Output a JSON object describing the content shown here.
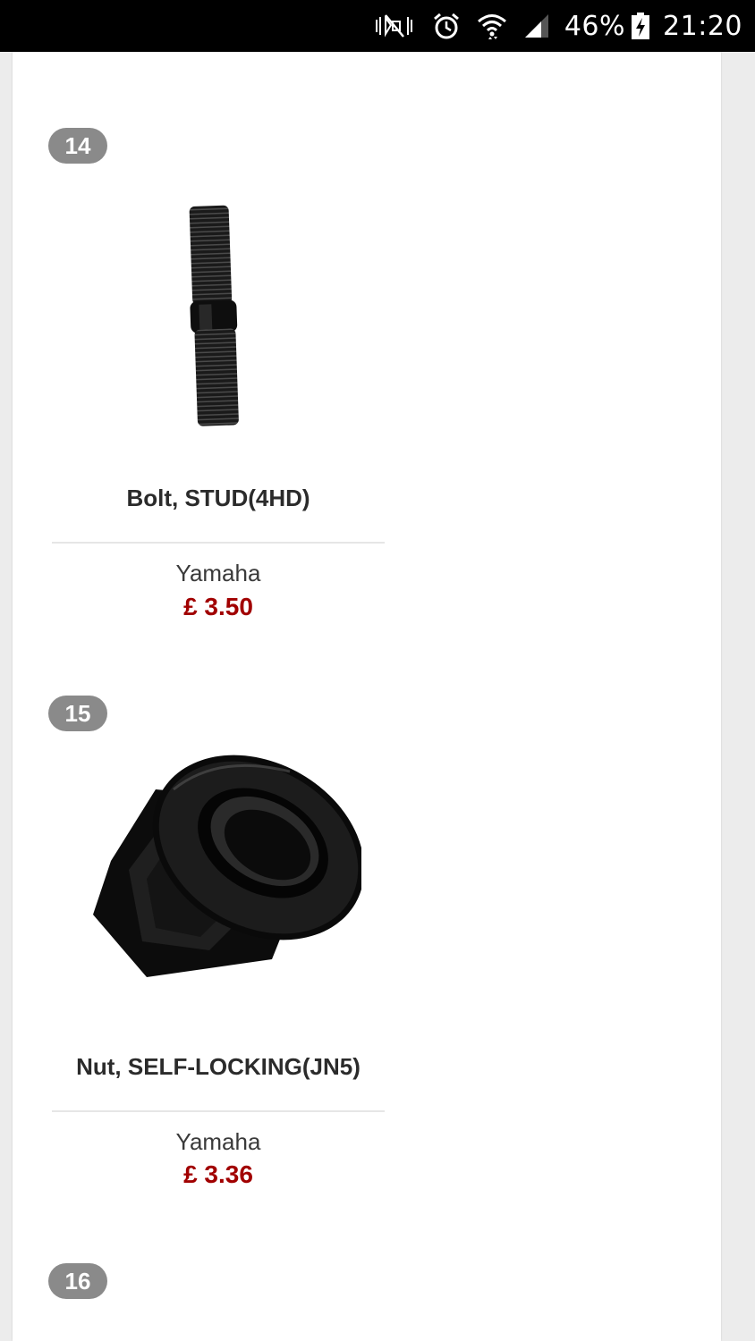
{
  "status_bar": {
    "battery_percent": "46%",
    "time": "21:20",
    "icons": [
      "mute-icon",
      "alarm-icon",
      "wifi-icon",
      "signal-icon",
      "battery-charging-icon"
    ]
  },
  "products": [
    {
      "number": "14",
      "name": "Bolt, STUD(4HD)",
      "brand": "Yamaha",
      "price": "£ 3.50",
      "image": "stud-bolt-image"
    },
    {
      "number": "15",
      "name": "Nut, SELF-LOCKING(JN5)",
      "brand": "Yamaha",
      "price": "£ 3.36",
      "image": "flange-nut-image"
    },
    {
      "number": "16"
    }
  ],
  "colors": {
    "price": "#a10000",
    "badge": "#8a8a8a",
    "status_bar": "#000000"
  }
}
